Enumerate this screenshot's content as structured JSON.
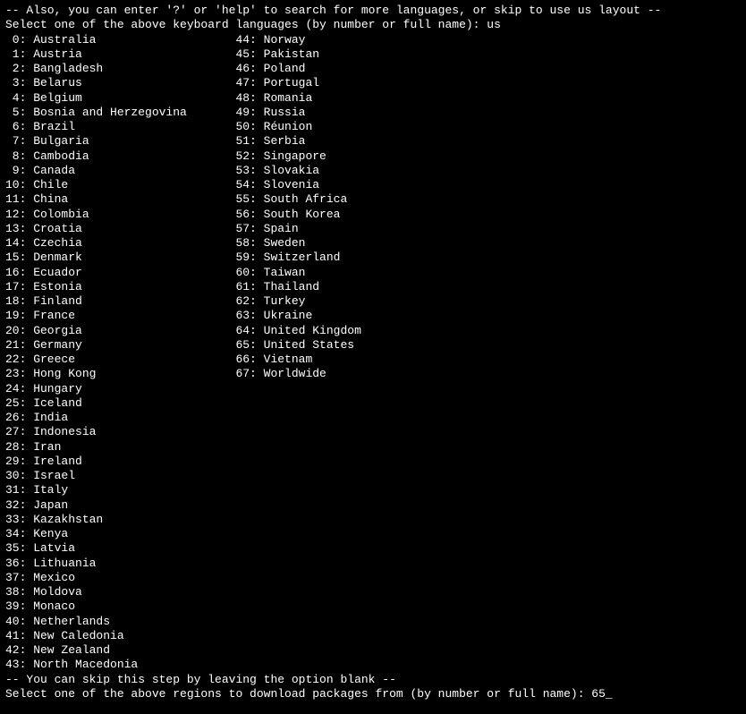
{
  "terminal": {
    "lines": [
      "-- Also, you can enter '?' or 'help' to search for more languages, or skip to use us layout --",
      "Select one of the above keyboard languages (by number or full name): us",
      " 0: Australia                    44: Norway",
      " 1: Austria                      45: Pakistan",
      " 2: Bangladesh                   46: Poland",
      " 3: Belarus                      47: Portugal",
      " 4: Belgium                      48: Romania",
      " 5: Bosnia and Herzegovina       49: Russia",
      " 6: Brazil                       50: Réunion",
      " 7: Bulgaria                     51: Serbia",
      " 8: Cambodia                     52: Singapore",
      " 9: Canada                       53: Slovakia",
      "10: Chile                        54: Slovenia",
      "11: China                        55: South Africa",
      "12: Colombia                     56: South Korea",
      "13: Croatia                      57: Spain",
      "14: Czechia                      58: Sweden",
      "15: Denmark                      59: Switzerland",
      "16: Ecuador                      60: Taiwan",
      "17: Estonia                      61: Thailand",
      "18: Finland                      62: Turkey",
      "19: France                       63: Ukraine",
      "20: Georgia                      64: United Kingdom",
      "21: Germany                      65: United States",
      "22: Greece                       66: Vietnam",
      "23: Hong Kong                    67: Worldwide",
      "24: Hungary",
      "25: Iceland",
      "26: India",
      "27: Indonesia",
      "28: Iran",
      "29: Ireland",
      "30: Israel",
      "31: Italy",
      "32: Japan",
      "33: Kazakhstan",
      "34: Kenya",
      "35: Latvia",
      "36: Lithuania",
      "37: Mexico",
      "38: Moldova",
      "39: Monaco",
      "40: Netherlands",
      "41: New Caledonia",
      "42: New Zealand",
      "43: North Macedonia",
      "-- You can skip this step by leaving the option blank --",
      "Select one of the above regions to download packages from (by number or full name): 65_"
    ]
  }
}
